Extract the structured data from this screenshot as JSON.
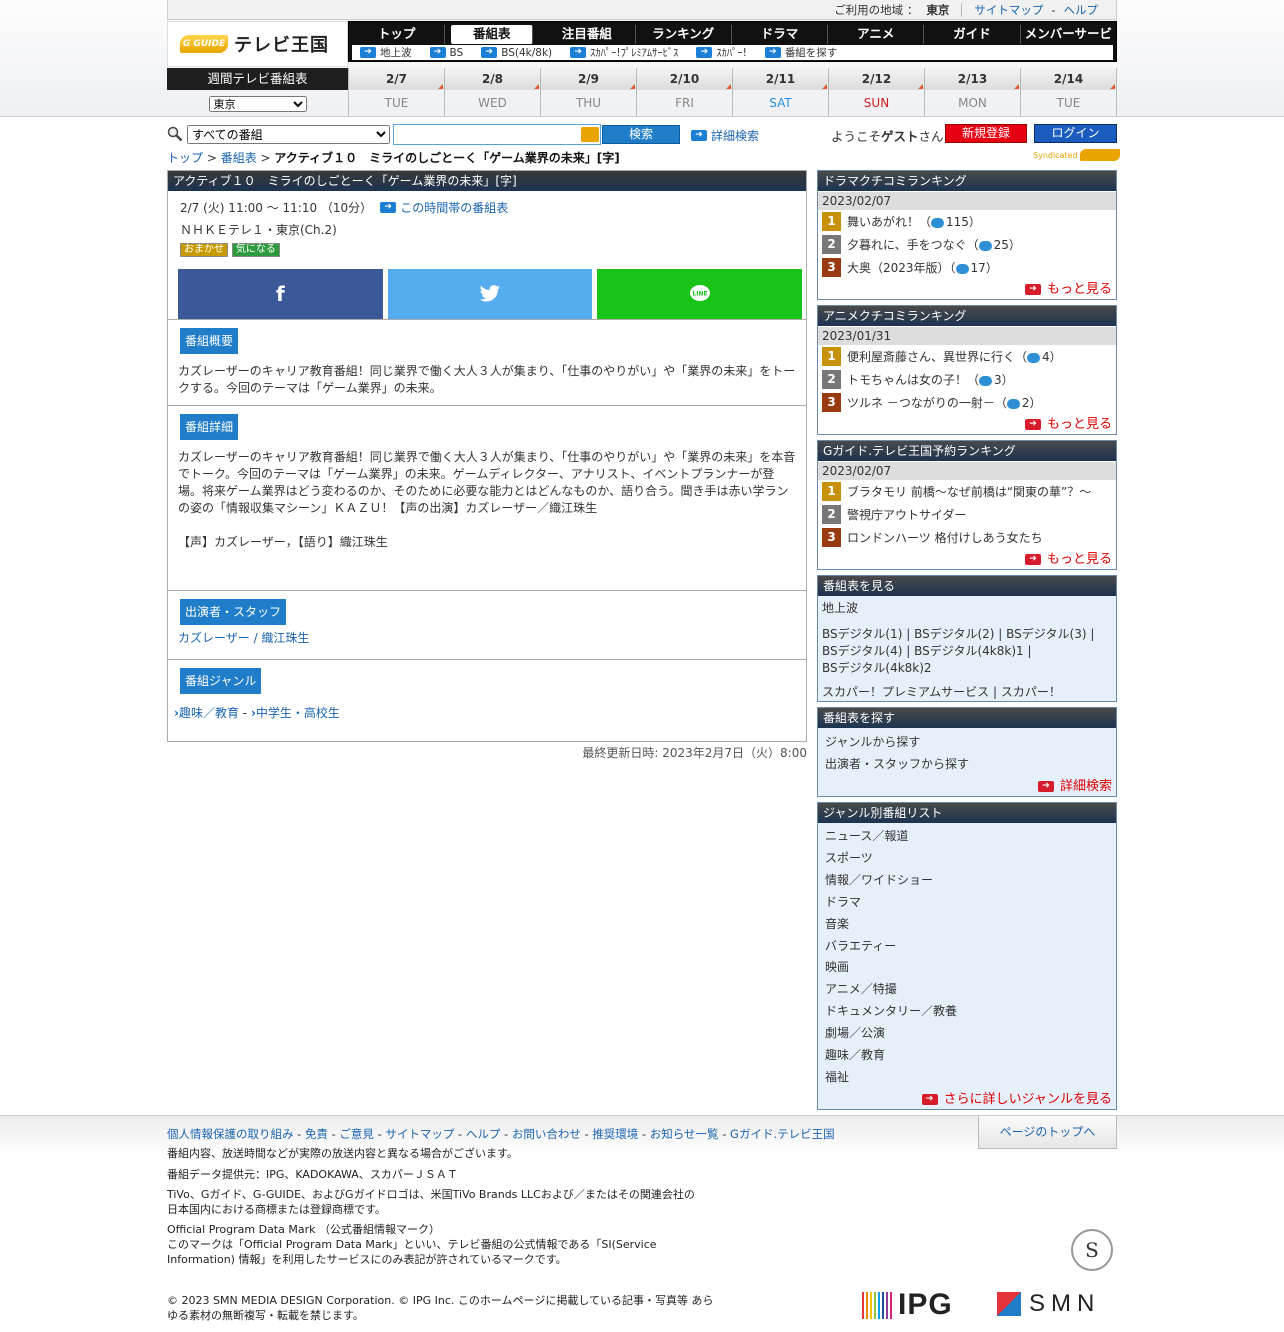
{
  "util": {
    "region_label": "ご利用の地域 ：",
    "region": "東京",
    "sitemap": "サイトマップ",
    "dash": "-",
    "help": "ヘルプ"
  },
  "logo": {
    "mark": "G GUIDE",
    "text": "テレビ王国"
  },
  "nav": {
    "items": [
      "トップ",
      "番組表",
      "注目番組",
      "ランキング",
      "ドラマ",
      "アニメ",
      "ガイド",
      "メンバーサービス"
    ],
    "sub": [
      "地上波",
      "BS",
      "BS(4k/8k)",
      "ｽｶﾊﾟｰ!ﾌﾟﾚﾐｱﾑｻｰﾋﾞｽ",
      "ｽｶﾊﾟｰ!",
      "番組を探す"
    ]
  },
  "week": {
    "label": "週間テレビ番組表",
    "region": "東京",
    "days": [
      {
        "d": "2/7",
        "w": "TUE"
      },
      {
        "d": "2/8",
        "w": "WED"
      },
      {
        "d": "2/9",
        "w": "THU"
      },
      {
        "d": "2/10",
        "w": "FRI"
      },
      {
        "d": "2/11",
        "w": "SAT"
      },
      {
        "d": "2/12",
        "w": "SUN"
      },
      {
        "d": "2/13",
        "w": "MON"
      },
      {
        "d": "2/14",
        "w": "TUE"
      }
    ]
  },
  "search": {
    "category": "すべての番組",
    "button": "検索",
    "detail": "詳細検索",
    "welcome_pre": "ようこそ",
    "welcome_name": "ゲスト",
    "welcome_post": "さん",
    "register": "新規登録",
    "login": "ログイン"
  },
  "crumb": {
    "top": "トップ",
    "gt1": " > ",
    "schedule": "番組表",
    "gt2": " > ",
    "current": "アクティブ１０　ミライのしごとーく「ゲーム業界の未来」[字]"
  },
  "synd": "Syndicated",
  "program": {
    "title": "アクティブ１０　ミライのしごとーく「ゲーム業界の未来」[字]",
    "time": "2/7 (火) 11:00 ～ 11:10 （10分）",
    "timeslot_link": "この時間帯の番組表",
    "channel": "ＮＨＫＥテレ１・東京(Ch.2)",
    "tags": [
      "おまかせ",
      "気になる"
    ],
    "overview_h": "番組概要",
    "overview": "カズレーザーのキャリア教育番組！同じ業界で働く大人３人が集まり、「仕事のやりがい」や「業界の未来」をトークする。今回のテーマは「ゲーム業界」の未来。",
    "detail_h": "番組詳細",
    "detail": "カズレーザーのキャリア教育番組！同じ業界で働く大人３人が集まり、「仕事のやりがい」や「業界の未来」を本音でトーク。今回のテーマは「ゲーム業界」の未来。ゲームディレクター、アナリスト、イベントプランナーが登場。将来ゲーム業界はどう変わるのか、そのために必要な能力とはどんなものか、語り合う。聞き手は赤い学ランの姿の「情報収集マシーン」ＫＡＺＵ！【声の出演】カズレーザー／織江珠生",
    "detail2": "【声】カズレーザー，【語り】織江珠生",
    "cast_h": "出演者・スタッフ",
    "cast": "カズレーザー / 織江珠生",
    "genre_h": "番組ジャンル",
    "genre1": "趣味／教育",
    "genre_sep": " - ",
    "genre2": "中学生・高校生",
    "updated": "最終更新日時: 2023年2月7日（火）8:00"
  },
  "side": {
    "drama": {
      "title": "ドラマクチコミランキング",
      "date": "2023/02/07",
      "items": [
        {
          "t": "舞いあがれ！（",
          "c": "115）"
        },
        {
          "t": "夕暮れに、手をつなぐ（",
          "c": "25）"
        },
        {
          "t": "大奥（2023年版）（",
          "c": "17）"
        }
      ],
      "more": "もっと見る"
    },
    "anime": {
      "title": "アニメクチコミランキング",
      "date": "2023/01/31",
      "items": [
        {
          "t": "便利屋斎藤さん、異世界に行く（",
          "c": "4）"
        },
        {
          "t": "トモちゃんは女の子！（",
          "c": "3）"
        },
        {
          "t": "ツルネ －つながりの一射－（",
          "c": "2）"
        }
      ],
      "more": "もっと見る"
    },
    "reserve": {
      "title": "Gガイド.テレビ王国予約ランキング",
      "date": "2023/02/07",
      "items": [
        "ブラタモリ 前橋〜なぜ前橋は“関東の華”？〜",
        "警視庁アウトサイダー",
        "ロンドンハーツ 格付けしあう女たち"
      ],
      "more": "もっと見る"
    },
    "view": {
      "title": "番組表を見る",
      "ch1": "地上波",
      "ch2a": "BSデジタル(1) | BSデジタル(2) | BSデジタル(3) |",
      "ch2b": "BSデジタル(4) | BSデジタル(4k8k)1 |",
      "ch2c": "BSデジタル(4k8k)2",
      "ch3": "スカパー！プレミアムサービス | スカパー！"
    },
    "find": {
      "title": "番組表を探す",
      "a": "ジャンルから探す",
      "b": "出演者・スタッフから探す",
      "more": "詳細検索"
    },
    "genres": {
      "title": "ジャンル別番組リスト",
      "items": [
        "ニュース／報道",
        "スポーツ",
        "情報／ワイドショー",
        "ドラマ",
        "音楽",
        "バラエティー",
        "映画",
        "アニメ／特撮",
        "ドキュメンタリー／教養",
        "劇場／公演",
        "趣味／教育",
        "福祉"
      ],
      "more": "さらに詳しいジャンルを見る"
    }
  },
  "footer": {
    "links": [
      "個人情報保護の取り組み",
      "免責",
      "ご意見",
      "サイトマップ",
      "ヘルプ",
      "お問い合わせ",
      "推奨環境",
      "お知らせ一覧",
      "Gガイド.テレビ王国"
    ],
    "sep": " - ",
    "pagetop": "ページのトップへ",
    "t1": "番組内容、放送時間などが実際の放送内容と異なる場合がございます。",
    "t2": "番組データ提供元：IPG、KADOKAWA、スカパーＪＳＡＴ",
    "t3a": "TiVo、Gガイド、G-GUIDE、およびGガイドロゴは、米国TiVo Brands LLCおよび／またはその関連会社の",
    "t3b": "日本国内における商標または登録商標です。",
    "t4a": "Official Program Data Mark （公式番組情報マーク）",
    "t4b": "このマークは「Official Program Data Mark」といい、テレビ番組の公式情報である「SI(Service",
    "t4c": "Information) 情報」を利用したサービスにのみ表記が許されているマークです。",
    "t5a": "© 2023 SMN MEDIA DESIGN Corporation. © IPG Inc. このホームページに掲載している記事・写真等 あら",
    "t5b": "ゆる素材の無断複写・転載を禁じます。",
    "seal": "S",
    "ipg": "IPG",
    "smn": "SMN"
  }
}
